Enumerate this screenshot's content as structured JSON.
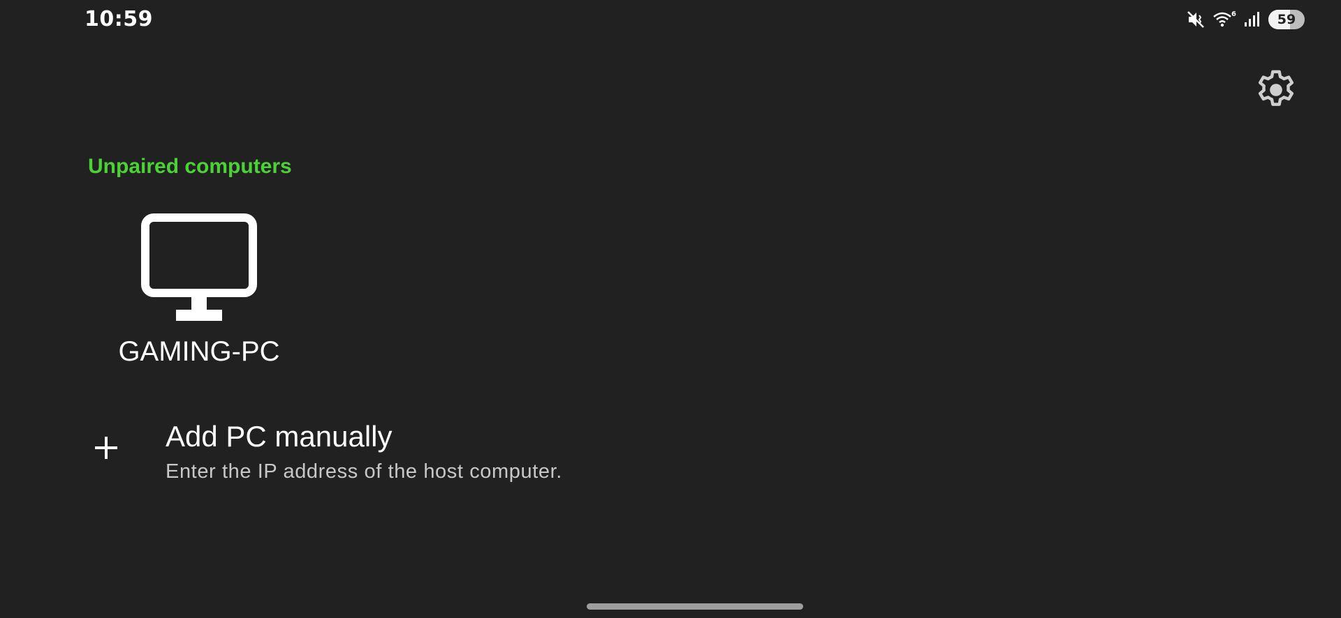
{
  "status_bar": {
    "time": "10:59",
    "icons": [
      "mute-vibrate-icon",
      "wifi-6-icon",
      "cellular-signal-icon"
    ],
    "battery": {
      "level_text": "59",
      "level_percent": 59
    }
  },
  "settings": {
    "icon": "gear-icon"
  },
  "section": {
    "header": "Unpaired computers",
    "header_color": "#4cd137"
  },
  "computers": [
    {
      "name": "GAMING-PC",
      "icon": "monitor-icon"
    }
  ],
  "add_pc": {
    "icon": "plus-icon",
    "title": "Add PC manually",
    "subtitle": "Enter the IP address of the host computer."
  }
}
